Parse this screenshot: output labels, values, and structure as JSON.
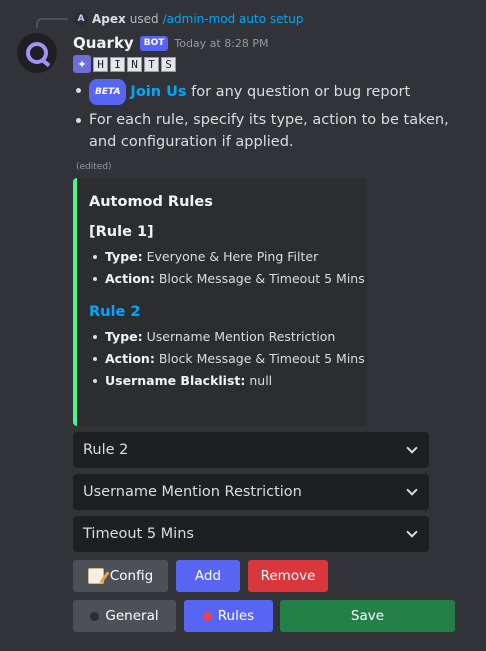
{
  "reply": {
    "user": "Apex",
    "verb": "used",
    "command": "/admin-mod auto setup"
  },
  "message": {
    "author": "Quarky",
    "bot_tag": "BOT",
    "timestamp": "Today at 8:28 PM",
    "hint_letters": [
      "H",
      "I",
      "N",
      "T",
      "S"
    ],
    "bullets": {
      "beta_badge": "BETA",
      "join_link": "Join Us",
      "join_text": " for any question or bug report",
      "instruction": "For each rule, specify its type, action to be taken, and configuration if applied."
    },
    "edited": "(edited)"
  },
  "embed": {
    "accent_color": "#57f287",
    "title": "Automod Rules",
    "rules": [
      {
        "heading": "[Rule 1]",
        "items": [
          {
            "label": "Type:",
            "value": " Everyone & Here Ping Filter"
          },
          {
            "label": "Action:",
            "value": " Block Message  & Timeout 5 Mins"
          }
        ]
      },
      {
        "heading": "Rule 2",
        "items": [
          {
            "label": "Type:",
            "value": " Username Mention Restriction"
          },
          {
            "label": "Action:",
            "value": " Block Message  & Timeout 5 Mins"
          },
          {
            "label": "Username Blacklist:",
            "value": " null"
          }
        ]
      }
    ]
  },
  "selects": [
    {
      "value": "Rule 2"
    },
    {
      "value": "Username Mention Restriction"
    },
    {
      "value": "Timeout 5 Mins"
    }
  ],
  "buttons": {
    "config": "Config",
    "add": "Add",
    "remove": "Remove",
    "general": "General",
    "rules": "Rules",
    "save": "Save"
  },
  "colors": {
    "background": "#313338",
    "blurple": "#5865f2",
    "danger": "#da373c",
    "success": "#248046",
    "link": "#00a8fc"
  }
}
